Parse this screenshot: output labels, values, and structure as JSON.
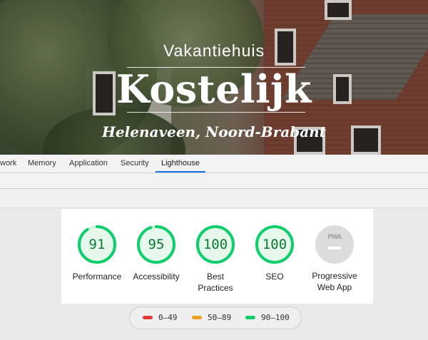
{
  "hero": {
    "pre_title": "Vakantiehuis",
    "title": "Kostelijk",
    "location": "Helenaveen, Noord-Brabant"
  },
  "devtools": {
    "tabs": [
      {
        "label": "work",
        "active": false
      },
      {
        "label": "Memory",
        "active": false
      },
      {
        "label": "Application",
        "active": false
      },
      {
        "label": "Security",
        "active": false
      },
      {
        "label": "Lighthouse",
        "active": true
      }
    ],
    "accent_color": "#1a73e8"
  },
  "lighthouse": {
    "categories": [
      {
        "label": "Performance",
        "score": "91",
        "fraction": 0.91,
        "icon": "gauge-circle"
      },
      {
        "label": "Accessibility",
        "score": "95",
        "fraction": 0.95,
        "icon": "gauge-circle"
      },
      {
        "label": "Best Practices",
        "score": "100",
        "fraction": 1.0,
        "icon": "gauge-circle"
      },
      {
        "label": "SEO",
        "score": "100",
        "fraction": 1.0,
        "icon": "gauge-circle"
      },
      {
        "label": "Progressive Web App",
        "score": "",
        "icon": "pwa-icon",
        "badge": "PWA"
      }
    ],
    "pass_color": "#0cce6b",
    "legend": [
      {
        "label": "0–49",
        "color": "#e53935"
      },
      {
        "label": "50–89",
        "color": "#f0a020"
      },
      {
        "label": "90–100",
        "color": "#0cce6b"
      }
    ]
  }
}
